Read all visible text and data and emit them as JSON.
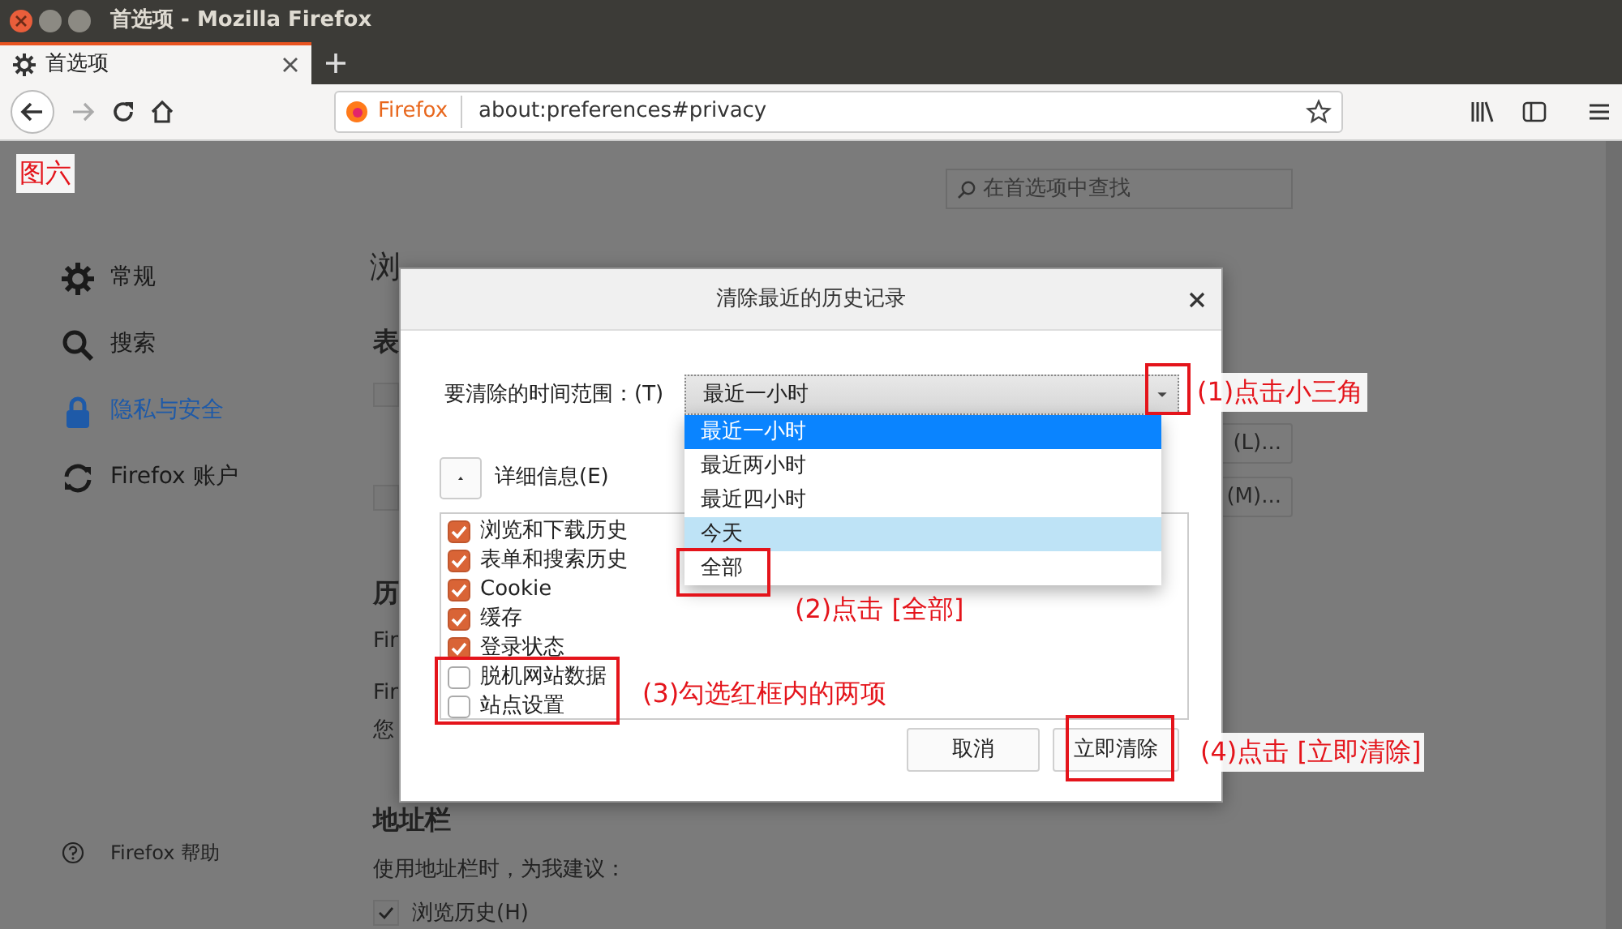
{
  "window": {
    "title": "首选项 - Mozilla Firefox"
  },
  "tabs": [
    {
      "label": "首选项",
      "selected": true
    }
  ],
  "toolbar": {
    "identity": "Firefox",
    "url": "about:preferences#privacy"
  },
  "search": {
    "placeholder": "在首选项中查找"
  },
  "sidebar": {
    "items": [
      {
        "label": "常规",
        "selected": false
      },
      {
        "label": "搜索",
        "selected": false
      },
      {
        "label": "隐私与安全",
        "selected": true
      },
      {
        "label": "Firefox 账户",
        "selected": false
      }
    ],
    "help": "Firefox 帮助"
  },
  "content": {
    "heading": "浏",
    "section_1": "表",
    "section_2": "历",
    "lines": [
      "Fir",
      "Fir",
      "您"
    ],
    "checkboxes": [
      {
        "checked": false
      },
      {
        "checked": false
      }
    ],
    "side_buttons": [
      "(L)...",
      "(M)..."
    ],
    "address_bar": {
      "heading": "地址栏",
      "description": "使用地址栏时，为我建议：",
      "options": [
        {
          "label": "浏览历史(H)",
          "checked": true
        }
      ]
    }
  },
  "dialog": {
    "title": "清除最近的历史记录",
    "range_label": "要清除的时间范围：(T)",
    "range_value": "最近一小时",
    "range_options": [
      {
        "label": "最近一小时",
        "selected": true,
        "highlighted": false
      },
      {
        "label": "最近两小时",
        "selected": false,
        "highlighted": false
      },
      {
        "label": "最近四小时",
        "selected": false,
        "highlighted": false
      },
      {
        "label": "今天",
        "selected": false,
        "highlighted": true
      },
      {
        "label": "全部",
        "selected": false,
        "highlighted": false
      }
    ],
    "details_label": "详细信息(E)",
    "items": [
      {
        "label": "浏览和下载历史",
        "checked": true
      },
      {
        "label": "表单和搜索历史",
        "checked": true
      },
      {
        "label": "Cookie",
        "checked": true
      },
      {
        "label": "缓存",
        "checked": true
      },
      {
        "label": "登录状态",
        "checked": true
      },
      {
        "label": "脱机网站数据",
        "checked": false
      },
      {
        "label": "站点设置",
        "checked": false
      }
    ],
    "buttons": [
      {
        "label": "取消"
      },
      {
        "label": "立即清除"
      }
    ]
  },
  "annotations": {
    "figure_label": "图六",
    "callouts": [
      {
        "text": "(1)点击小三角"
      },
      {
        "text": "(2)点击 [全部]"
      },
      {
        "text": "(3)勾选红框内的两项"
      },
      {
        "text": "(4)点击 [立即清除]"
      }
    ]
  }
}
